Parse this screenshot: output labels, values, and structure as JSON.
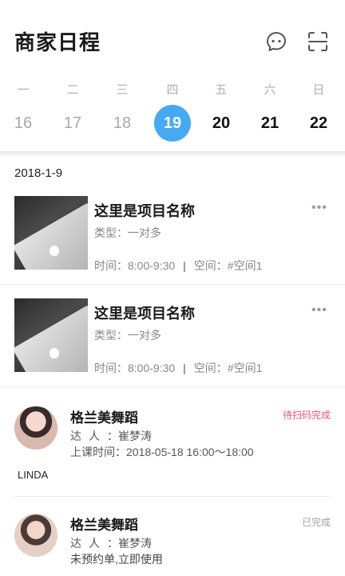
{
  "header": {
    "title": "商家日程",
    "icons": [
      "chat-bubble-icon",
      "scan-icon"
    ]
  },
  "week": {
    "weekdays": [
      "一",
      "二",
      "三",
      "四",
      "五",
      "六",
      "日"
    ],
    "days": [
      "16",
      "17",
      "18",
      "19",
      "20",
      "21",
      "22"
    ],
    "selected_day": "19",
    "selected_color": "#45aaf2"
  },
  "date_label": "2018-1-9",
  "projects": [
    {
      "title": "这里是项目名称",
      "type_label": "类型：一对多",
      "time_label": "时间：8:00-9:30",
      "separator": "|",
      "space_label": "空间：#空间1",
      "more": "•••"
    },
    {
      "title": "这里是项目名称",
      "type_label": "类型：一对多",
      "time_label": "时间：8:00-9:30",
      "separator": "|",
      "space_label": "空间：#空间1",
      "more": "•••"
    }
  ],
  "bookings": [
    {
      "name": "格兰美舞蹈",
      "status": "待扫码完成",
      "status_color": "#e8567a",
      "expert_key": "达人：",
      "expert_value": "崔梦涛",
      "time_key": "上课时间：",
      "time_value": "2018-05-18  16:00～18:00",
      "extra": "LINDA"
    },
    {
      "name": "格兰美舞蹈",
      "status": "已完成",
      "status_color": "#a0a0a0",
      "expert_key": "达人：",
      "expert_value": "崔梦涛",
      "note": "未预约单,立即使用"
    }
  ]
}
